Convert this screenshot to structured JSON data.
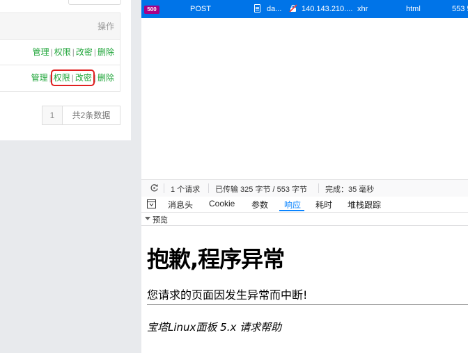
{
  "admin": {
    "table": {
      "action_header": "操作",
      "rows": [
        {
          "manage": "管理",
          "perm": "权限",
          "pwd": "改密",
          "del": "删除"
        },
        {
          "manage": "管理",
          "perm": "权限",
          "pwd": "改密",
          "del": "删除"
        }
      ],
      "separator": "|"
    },
    "pager": {
      "page": "1",
      "total": "共2条数据"
    }
  },
  "devtools": {
    "request": {
      "status": "500",
      "method": "POST",
      "file": "da...",
      "domain": "140.143.210....",
      "cause": "xhr",
      "type": "html",
      "size": "553 5"
    },
    "summary": {
      "count": "1 个请求",
      "transferred": "已传输 325 字节 / 553 字节",
      "finish": "完成：35 毫秒"
    },
    "tabs": [
      "消息头",
      "Cookie",
      "参数",
      "响应",
      "耗时",
      "堆栈跟踪"
    ],
    "active_tab": "响应",
    "preview_label": "预览",
    "response": {
      "heading": "抱歉,程序异常",
      "message": "您请求的页面因发生异常而中断!",
      "footer": "宝塔Linux面板 5.x 请求帮助"
    },
    "colors": {
      "selected_row": "#0074e8",
      "status_badge": "#a80086",
      "active_tab": "#0a84ff",
      "link_green": "#20a53a",
      "highlight_box": "#e02020"
    }
  }
}
